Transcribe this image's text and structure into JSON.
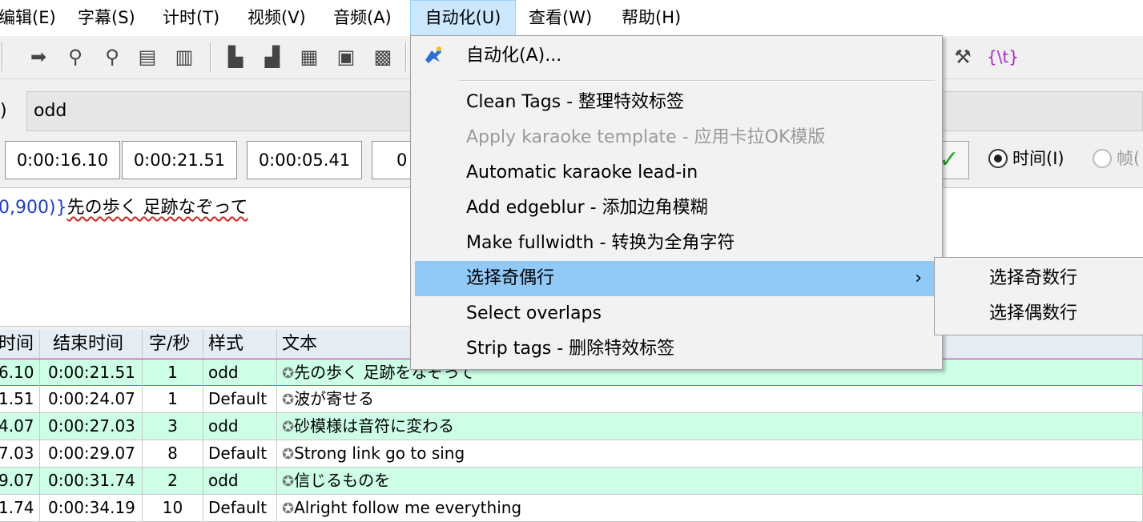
{
  "menubar": {
    "items": [
      "编辑(E)",
      "字幕(S)",
      "计时(T)",
      "视频(V)",
      "音频(A)",
      "自动化(U)",
      "查看(W)",
      "帮助(H)"
    ]
  },
  "toolbar": {
    "right_tag_label": "{\\t}"
  },
  "style_row": {
    "paren": ")",
    "style_value": "odd"
  },
  "time_row": {
    "start": "0:00:16.10",
    "end": "0:00:21.51",
    "duration": "0:00:05.41",
    "partial": "0",
    "radio_time_label": "时间(I)",
    "radio_frame_label": "帧("
  },
  "text_edit": {
    "tag_text": "0,900)}",
    "line_text": "先の歩く 足跡なぞって"
  },
  "grid": {
    "headers": [
      "时间",
      "结束时间",
      "字/秒",
      "样式",
      "文本"
    ],
    "rows": [
      {
        "start": "6.10",
        "end": "0:00:21.51",
        "cps": "1",
        "style": "odd",
        "text": "先の歩く 足跡をなぞって",
        "selected": true
      },
      {
        "start": "1.51",
        "end": "0:00:24.07",
        "cps": "1",
        "style": "Default",
        "text": "波が寄せる",
        "selected": false
      },
      {
        "start": "4.07",
        "end": "0:00:27.03",
        "cps": "3",
        "style": "odd",
        "text": "砂模様は音符に変わる",
        "selected": false
      },
      {
        "start": "7.03",
        "end": "0:00:29.07",
        "cps": "8",
        "style": "Default",
        "text": "Strong link go to sing",
        "selected": false
      },
      {
        "start": "9.07",
        "end": "0:00:31.74",
        "cps": "2",
        "style": "odd",
        "text": "信じるものを",
        "selected": false
      },
      {
        "start": "1.74",
        "end": "0:00:34.19",
        "cps": "10",
        "style": "Default",
        "text": "Alright follow me everything",
        "selected": false
      }
    ],
    "odd_row_color": "#ccffe6",
    "default_row_color": "#ffffff"
  },
  "automation_menu": {
    "items": [
      {
        "label": "自动化(A)...",
        "disabled": false
      },
      {
        "label": "Clean Tags - 整理特效标签",
        "disabled": false
      },
      {
        "label": "Apply karaoke template - 应用卡拉OK模版",
        "disabled": true
      },
      {
        "label": "Automatic karaoke lead-in",
        "disabled": false
      },
      {
        "label": "Add edgeblur - 添加边角模糊",
        "disabled": false
      },
      {
        "label": "Make fullwidth - 转换为全角字符",
        "disabled": false
      },
      {
        "label": "选择奇偶行",
        "disabled": false,
        "submenu": true
      },
      {
        "label": "Select overlaps",
        "disabled": false
      },
      {
        "label": "Strip tags - 删除特效标签",
        "disabled": false
      }
    ],
    "submenu_chevron": "›"
  },
  "submenu": {
    "items": [
      "选择奇数行",
      "选择偶数行"
    ]
  },
  "colors": {
    "highlight": "#91c9f7",
    "menubar_active": "#cce8ff",
    "tag_blue": "#1e3fcc",
    "check_green": "#2aa12a"
  }
}
